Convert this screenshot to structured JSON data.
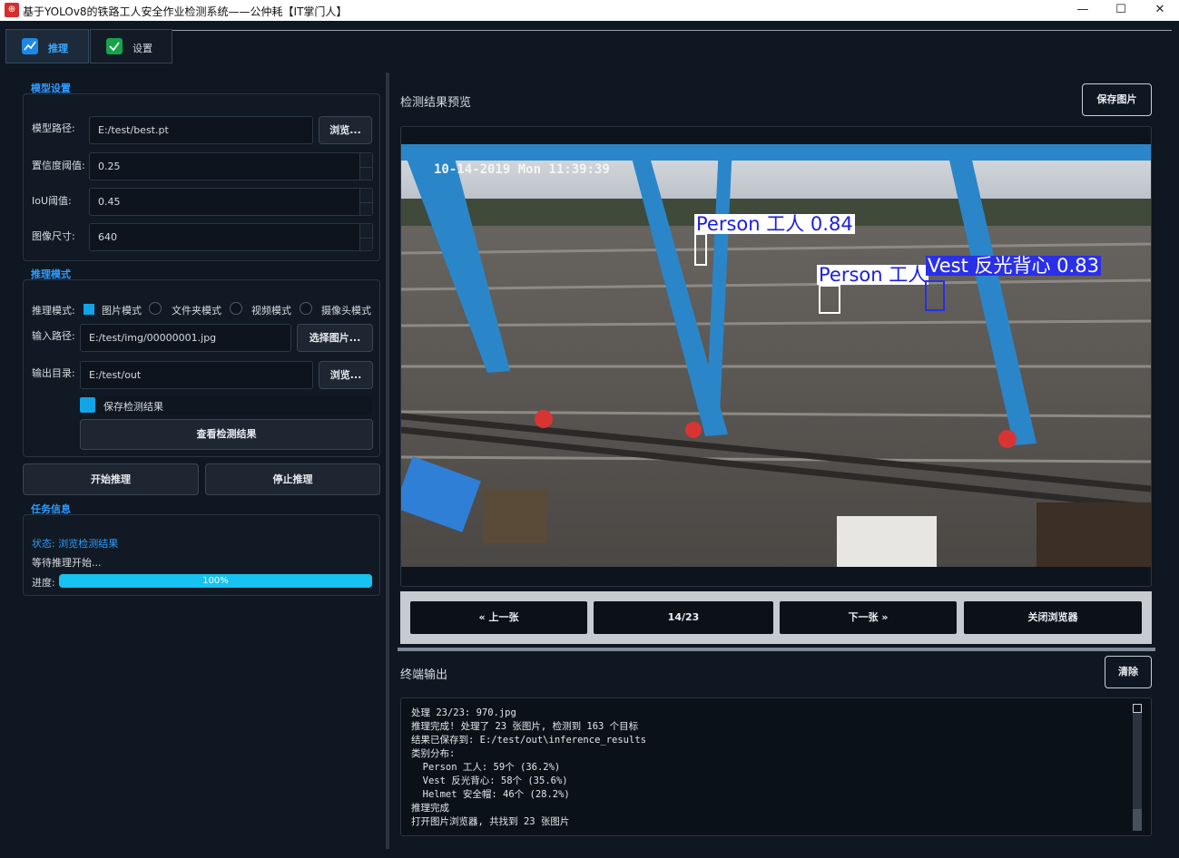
{
  "window": {
    "title": "基于YOLOv8的铁路工人安全作业检测系统——公仲耗【IT掌门人】",
    "minimize": "—",
    "maximize": "☐",
    "close": "✕"
  },
  "tabs": [
    {
      "label": "推理",
      "icon": "chart-line-icon",
      "active": true
    },
    {
      "label": "设置",
      "icon": "check-badge-icon",
      "active": false
    }
  ],
  "model_settings": {
    "section_title": "模型设置",
    "model_path_label": "模型路径:",
    "model_path": "E:/test/best.pt",
    "browse": "浏览...",
    "conf_label": "置信度阈值:",
    "conf": "0.25",
    "iou_label": "IoU阈值:",
    "iou": "0.45",
    "imgsz_label": "图像尺寸:",
    "imgsz": "640"
  },
  "inference_mode": {
    "section_title": "推理模式",
    "mode_label": "推理模式:",
    "modes": [
      "图片模式",
      "文件夹模式",
      "视频模式",
      "摄像头模式"
    ],
    "selected_mode": "图片模式",
    "input_label": "输入路径:",
    "input_path": "E:/test/img/00000001.jpg",
    "select_images": "选择图片...",
    "output_label": "输出目录:",
    "output_dir": "E:/test/out",
    "browse": "浏览...",
    "save_results": "保存检测结果",
    "view_results": "查看检测结果"
  },
  "actions": {
    "start": "开始推理",
    "stop": "停止推理"
  },
  "task_info": {
    "section_title": "任务信息",
    "status": "状态: 浏览检测结果",
    "message": "等待推理开始...",
    "progress_label": "进度:",
    "progress": 100,
    "progress_text": "100%"
  },
  "preview": {
    "title": "检测结果预览",
    "save_image": "保存图片",
    "timestamp_overlay": "10-14-2019 Mon 11:39:39",
    "detections": [
      {
        "label": "Person 工人 0.84",
        "class": "person"
      },
      {
        "label": "Vest 反光背心 0.83",
        "class": "vest"
      },
      {
        "label": "Person 工人",
        "class": "person"
      },
      {
        "label": "Vest 反光背心 0.83",
        "class": "vest"
      }
    ]
  },
  "navigator": {
    "prev": "« 上一张",
    "counter": "14/23",
    "next": "下一张 »",
    "close": "关闭浏览器"
  },
  "terminal": {
    "title": "终端输出",
    "clear": "清除",
    "lines": [
      "处理 23/23: 970.jpg",
      "推理完成! 处理了 23 张图片, 检测到 163 个目标",
      "结果已保存到: E:/test/out\\inference_results",
      "类别分布:",
      "  Person 工人: 59个 (36.2%)",
      "  Vest 反光背心: 58个 (35.6%)",
      "  Helmet 安全帽: 46个 (28.2%)",
      "推理完成",
      "打开图片浏览器, 共找到 23 张图片"
    ]
  },
  "colors": {
    "accent": "#2e9bff",
    "progress": "#17c3f0",
    "background": "#0f1722"
  }
}
